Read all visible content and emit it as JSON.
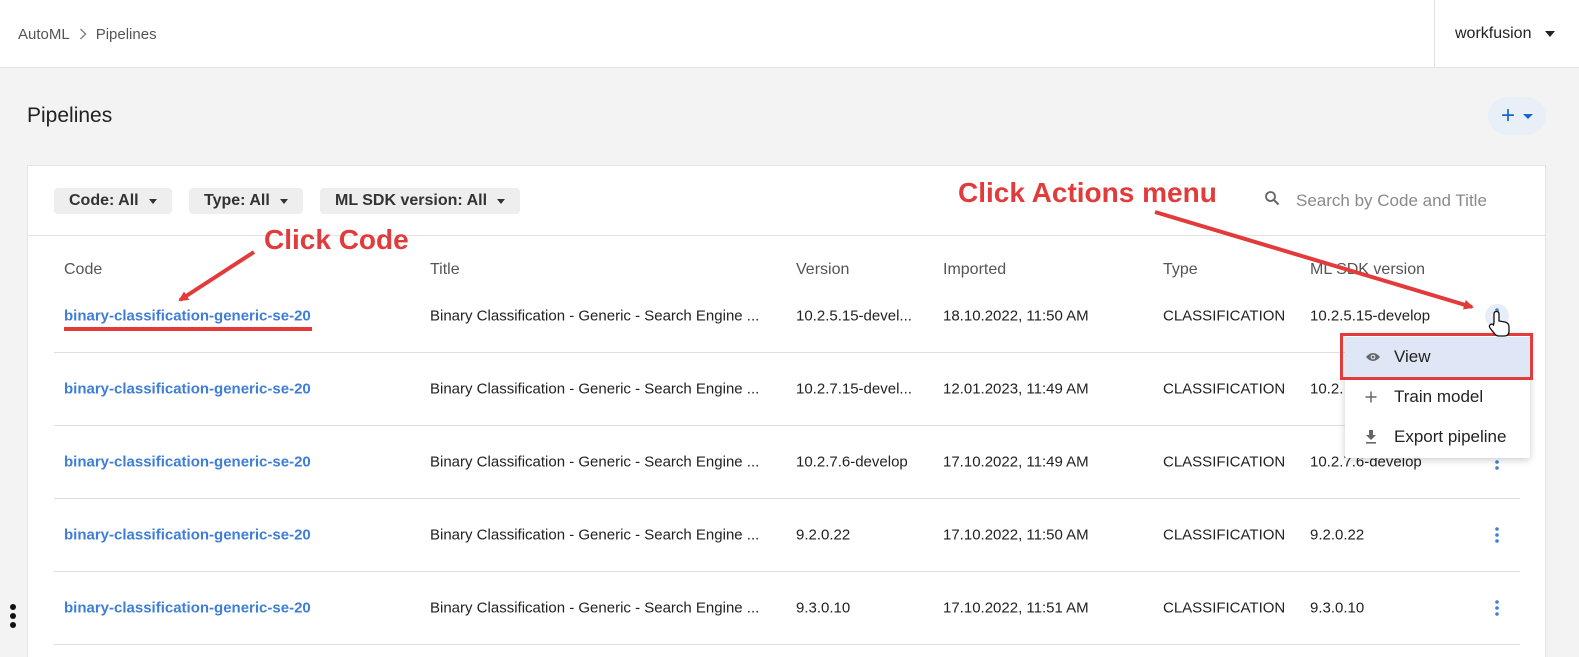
{
  "breadcrumb": {
    "items": [
      "AutoML",
      "Pipelines"
    ]
  },
  "user": {
    "name": "workfusion"
  },
  "page": {
    "title": "Pipelines",
    "add_label": "+"
  },
  "filters": [
    {
      "label": "Code: All"
    },
    {
      "label": "Type: All"
    },
    {
      "label": "ML SDK version: All"
    }
  ],
  "search": {
    "placeholder": "Search by Code and Title",
    "value": ""
  },
  "table": {
    "columns": [
      "Code",
      "Title",
      "Version",
      "Imported",
      "Type",
      "ML SDK version"
    ],
    "rows": [
      {
        "code": "binary-classification-generic-se-20",
        "title": "Binary Classification - Generic - Search Engine ...",
        "version": "10.2.5.15-devel...",
        "imported": "18.10.2022, 11:50 AM",
        "type": "CLASSIFICATION",
        "sdk": "10.2.5.15-develop"
      },
      {
        "code": "binary-classification-generic-se-20",
        "title": "Binary Classification - Generic - Search Engine ...",
        "version": "10.2.7.15-devel...",
        "imported": "12.01.2023, 11:49 AM",
        "type": "CLASSIFICATION",
        "sdk": "10.2."
      },
      {
        "code": "binary-classification-generic-se-20",
        "title": "Binary Classification - Generic - Search Engine ...",
        "version": "10.2.7.6-develop",
        "imported": "17.10.2022, 11:49 AM",
        "type": "CLASSIFICATION",
        "sdk": "10.2.7.6-develop"
      },
      {
        "code": "binary-classification-generic-se-20",
        "title": "Binary Classification - Generic - Search Engine ...",
        "version": "9.2.0.22",
        "imported": "17.10.2022, 11:50 AM",
        "type": "CLASSIFICATION",
        "sdk": "9.2.0.22"
      },
      {
        "code": "binary-classification-generic-se-20",
        "title": "Binary Classification - Generic - Search Engine ...",
        "version": "9.3.0.10",
        "imported": "17.10.2022, 11:51 AM",
        "type": "CLASSIFICATION",
        "sdk": "9.3.0.10"
      }
    ]
  },
  "actions_menu": {
    "items": [
      {
        "label": "View",
        "icon": "eye-icon"
      },
      {
        "label": "Train model",
        "icon": "plus-icon"
      },
      {
        "label": "Export pipeline",
        "icon": "download-icon"
      }
    ]
  },
  "annotations": {
    "click_code": "Click Code",
    "click_actions": "Click Actions menu"
  },
  "colors": {
    "accent": "#3f7ed8",
    "annotation": "#e23b3b",
    "menu_highlight": "#dfe6f5"
  }
}
